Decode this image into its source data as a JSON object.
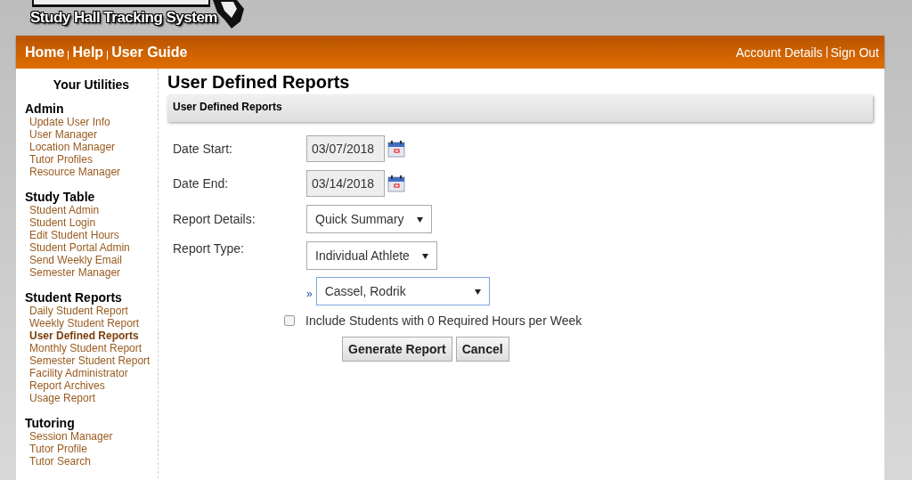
{
  "logo": {
    "subtitle": "Study Hall Tracking System"
  },
  "nav": {
    "left": [
      "Home",
      "Help",
      "User Guide"
    ],
    "right": [
      "Account Details",
      "Sign Out"
    ]
  },
  "sidebar": {
    "title": "Your Utilities",
    "groups": [
      {
        "heading": "Admin",
        "items": [
          {
            "label": "Update User Info",
            "selected": false
          },
          {
            "label": "User Manager",
            "selected": false
          },
          {
            "label": "Location Manager",
            "selected": false
          },
          {
            "label": "Tutor Profiles",
            "selected": false
          },
          {
            "label": "Resource Manager",
            "selected": false
          }
        ]
      },
      {
        "heading": "Study Table",
        "items": [
          {
            "label": "Student Admin",
            "selected": false
          },
          {
            "label": "Student Login",
            "selected": false
          },
          {
            "label": "Edit Student Hours",
            "selected": false
          },
          {
            "label": "Student Portal Admin",
            "selected": false
          },
          {
            "label": "Send Weekly Email",
            "selected": false
          },
          {
            "label": "Semester Manager",
            "selected": false
          }
        ]
      },
      {
        "heading": "Student Reports",
        "items": [
          {
            "label": "Daily Student Report",
            "selected": false
          },
          {
            "label": "Weekly Student Report",
            "selected": false
          },
          {
            "label": "User Defined Reports",
            "selected": true
          },
          {
            "label": "Monthly Student Report",
            "selected": false
          },
          {
            "label": "Semester Student Report",
            "selected": false
          },
          {
            "label": "Facility Administrator",
            "selected": false
          },
          {
            "label": "Report Archives",
            "selected": false
          },
          {
            "label": "Usage Report",
            "selected": false
          }
        ]
      },
      {
        "heading": "Tutoring",
        "items": [
          {
            "label": "Session Manager",
            "selected": false
          },
          {
            "label": "Tutor Profile",
            "selected": false
          },
          {
            "label": "Tutor Search",
            "selected": false
          }
        ]
      }
    ]
  },
  "page": {
    "title": "User Defined Reports",
    "panel_title": "User Defined Reports",
    "fields": [
      {
        "kind": "date",
        "label": "Date Start:",
        "value": "03/07/2018"
      },
      {
        "kind": "date",
        "label": "Date End:",
        "value": "03/14/2018"
      },
      {
        "kind": "select",
        "label": "Report Details:",
        "value": "Quick Summary"
      },
      {
        "kind": "select",
        "label": "Report Type:",
        "value": "Individual Athlete"
      }
    ],
    "student": {
      "marker": "»",
      "value": "Cassel, Rodrik"
    },
    "checkbox": {
      "label": "Include Students with 0 Required Hours per Week",
      "checked": false
    },
    "buttons": [
      "Generate Report",
      "Cancel"
    ]
  }
}
